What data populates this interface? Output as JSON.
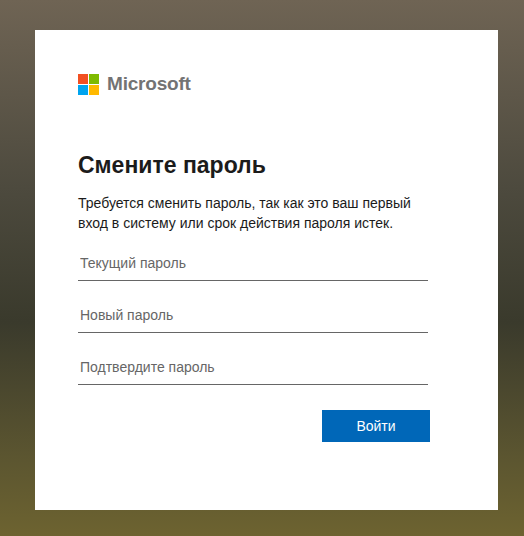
{
  "logo": {
    "text": "Microsoft"
  },
  "title": "Смените пароль",
  "description": "Требуется сменить пароль, так как это ваш первый вход в систему или срок действия пароля истек.",
  "fields": [
    {
      "placeholder": "Текущий пароль"
    },
    {
      "placeholder": "Новый пароль"
    },
    {
      "placeholder": "Подтвердите пароль"
    }
  ],
  "buttons": [
    {
      "label": "Войти"
    }
  ]
}
